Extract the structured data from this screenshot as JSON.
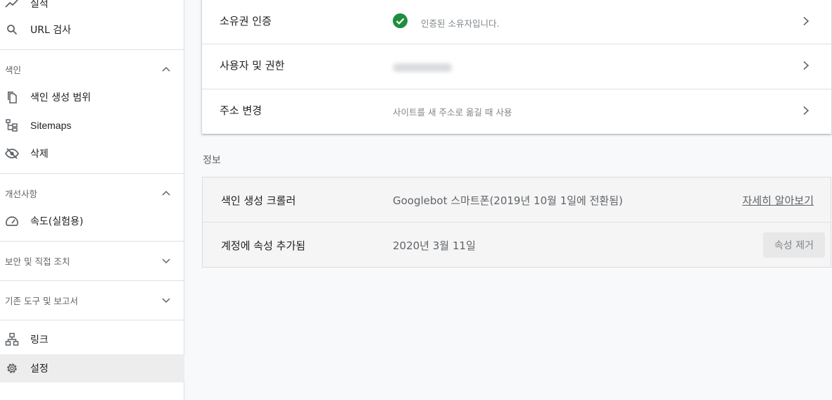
{
  "sidebar": {
    "top_items": [
      {
        "label": "실적",
        "icon": "trending-up-icon"
      },
      {
        "label": "URL 검사",
        "icon": "search-icon"
      }
    ],
    "sections": [
      {
        "title": "색인",
        "state": "expanded",
        "items": [
          {
            "label": "색인 생성 범위",
            "icon": "copy-pages-icon"
          },
          {
            "label": "Sitemaps",
            "icon": "sitemap-icon"
          },
          {
            "label": "삭제",
            "icon": "eye-off-icon"
          }
        ]
      },
      {
        "title": "개선사항",
        "state": "expanded",
        "items": [
          {
            "label": "속도(실험용)",
            "icon": "speed-gauge-icon"
          }
        ]
      },
      {
        "title": "보안 및 직접 조치",
        "state": "collapsed",
        "items": []
      },
      {
        "title": "기존 도구 및 보고서",
        "state": "collapsed",
        "items": []
      }
    ],
    "bottom_items": [
      {
        "label": "링크",
        "icon": "links-network-icon"
      },
      {
        "label": "설정",
        "icon": "gear-icon",
        "active": true
      }
    ]
  },
  "settings": {
    "rows": [
      {
        "name": "소유권 인증",
        "value": "인증된 소유자입니다.",
        "status_icon": "check-circle-icon"
      },
      {
        "name": "사용자 및 권한",
        "value": ""
      },
      {
        "name": "주소 변경",
        "value": "사이트를 새 주소로 옮길 때 사용"
      }
    ]
  },
  "info": {
    "title": "정보",
    "crawler": {
      "name": "색인 생성 크롤러",
      "value": "Googlebot 스마트폰(2019년 10월 1일에 전환됨)",
      "link": "자세히 알아보기"
    },
    "added": {
      "name": "계정에 속성 추가됨",
      "value": "2020년 3월 11일",
      "button": "속성 제거"
    }
  },
  "colors": {
    "check_green": "#1e8e3e",
    "active_bg": "#ededed",
    "text_primary": "#202124",
    "text_secondary": "#5f6368"
  }
}
